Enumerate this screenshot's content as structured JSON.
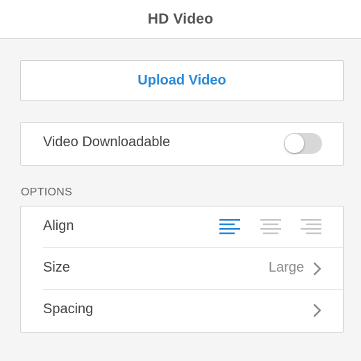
{
  "header": {
    "title": "HD Video"
  },
  "upload": {
    "label": "Upload Video"
  },
  "download": {
    "label": "Video Downloadable",
    "enabled": false
  },
  "options": {
    "heading": "OPTIONS",
    "align": {
      "label": "Align",
      "selected": "left",
      "choices": [
        "left-align-icon",
        "center-align-icon",
        "right-align-icon"
      ]
    },
    "size": {
      "label": "Size",
      "value": "Large"
    },
    "spacing": {
      "label": "Spacing"
    }
  },
  "colors": {
    "accent": "#2b8ad8",
    "inactive_icon": "#c8c8c8",
    "toggle_off": "#d8d8d8"
  }
}
